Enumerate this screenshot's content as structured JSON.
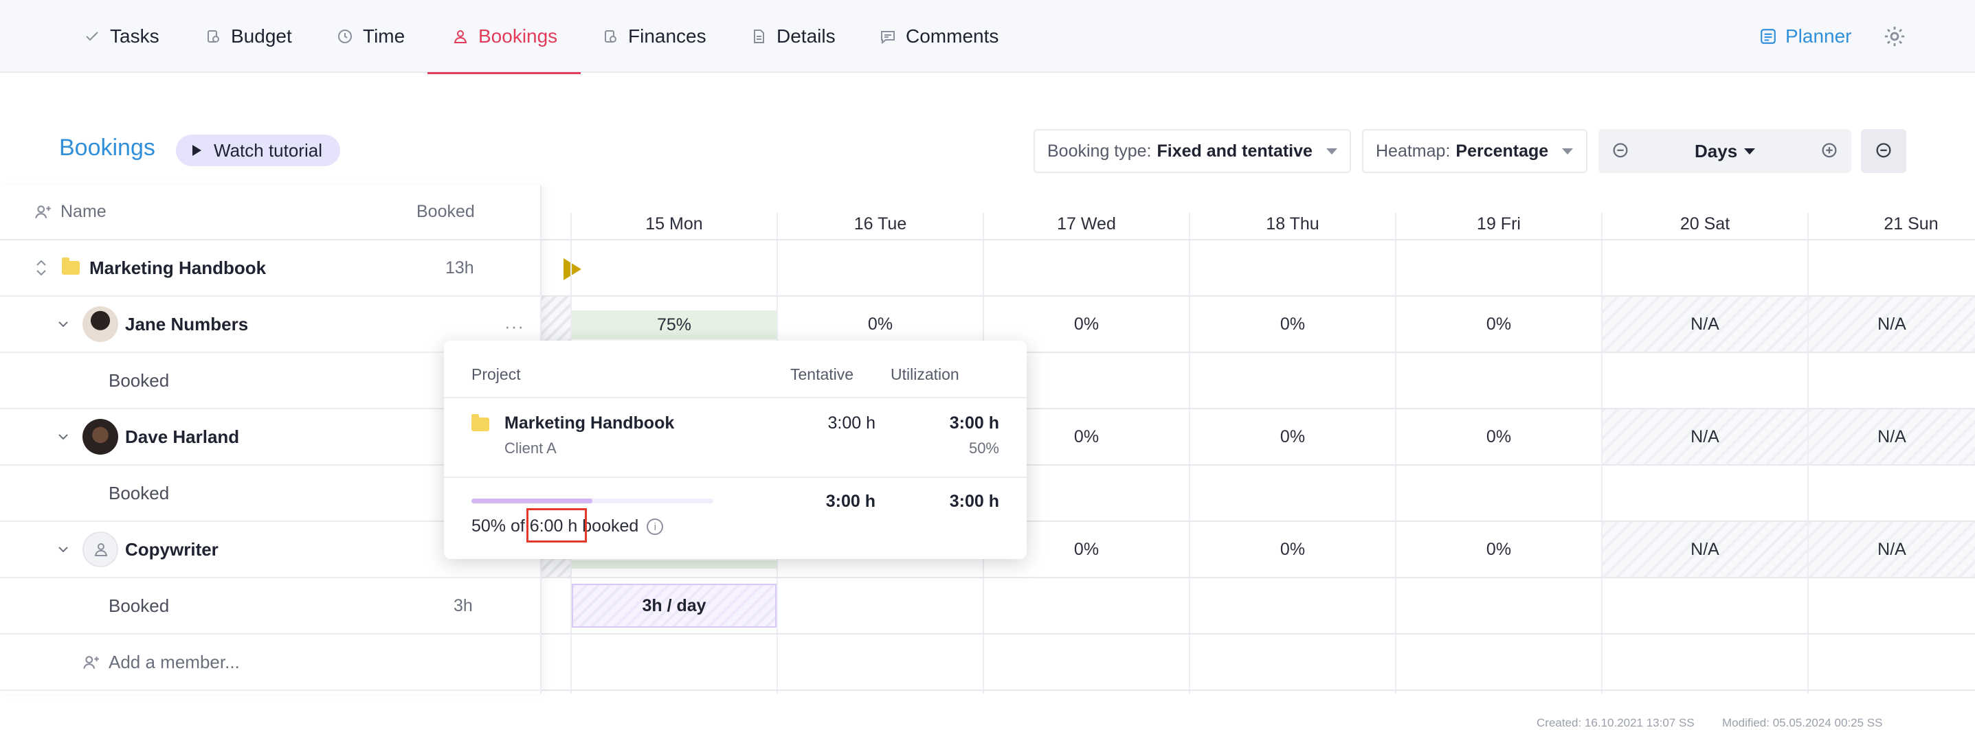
{
  "nav": {
    "tabs": [
      {
        "label": "Tasks",
        "icon": "check-icon"
      },
      {
        "label": "Budget",
        "icon": "budget-icon"
      },
      {
        "label": "Time",
        "icon": "clock-icon"
      },
      {
        "label": "Bookings",
        "icon": "bookings-icon",
        "active": true
      },
      {
        "label": "Finances",
        "icon": "finances-icon"
      },
      {
        "label": "Details",
        "icon": "document-icon"
      },
      {
        "label": "Comments",
        "icon": "comment-icon"
      }
    ],
    "planner_label": "Planner"
  },
  "header": {
    "title": "Bookings",
    "tutorial_label": "Watch tutorial",
    "booking_type": {
      "label": "Booking type:",
      "value": "Fixed and tentative"
    },
    "heatmap": {
      "label": "Heatmap:",
      "value": "Percentage"
    },
    "zoom": {
      "value": "Days"
    }
  },
  "table": {
    "name_header": "Name",
    "booked_header": "Booked",
    "project": {
      "name": "Marketing Handbook",
      "booked": "13h"
    },
    "members": [
      {
        "name": "Jane Numbers",
        "sub_label": "Booked"
      },
      {
        "name": "Dave Harland",
        "sub_label": "Booked"
      },
      {
        "name": "Copywriter",
        "sub_label": "Booked",
        "sub_value": "3h"
      }
    ],
    "add_member": "Add a member..."
  },
  "days": [
    "15 Mon",
    "16 Tue",
    "17 Wed",
    "18 Thu",
    "19 Fri",
    "20 Sat",
    "21 Sun"
  ],
  "rows": {
    "jane": [
      "75%",
      "0%",
      "0%",
      "0%",
      "0%",
      "N/A",
      "N/A"
    ],
    "dave": [
      "",
      "",
      "0%",
      "0%",
      "0%",
      "N/A",
      "N/A"
    ],
    "copywriter": [
      "",
      "",
      "0%",
      "0%",
      "0%",
      "N/A",
      "N/A"
    ],
    "copywriter_booking": "3h / day"
  },
  "popover": {
    "col_project": "Project",
    "col_tentative": "Tentative",
    "col_utilization": "Utilization",
    "project_name": "Marketing Handbook",
    "client": "Client A",
    "tentative": "3:00 h",
    "utilization": "3:00 h",
    "utilization_pct": "50%",
    "total_tentative": "3:00 h",
    "total_utilization": "3:00 h",
    "summary_prefix": "50% of",
    "summary_hours": "6:00 h",
    "summary_suffix": "booked",
    "progress": 0.5
  },
  "footer": {
    "created": "Created: 16.10.2021 13:07 SS",
    "modified": "Modified: 05.05.2024 00:25 SS"
  },
  "colors": {
    "accent": "#e23b5b",
    "link": "#2f8fd9",
    "planner_green": "#e5f1e2",
    "booking_purple": "#ede7fb"
  }
}
